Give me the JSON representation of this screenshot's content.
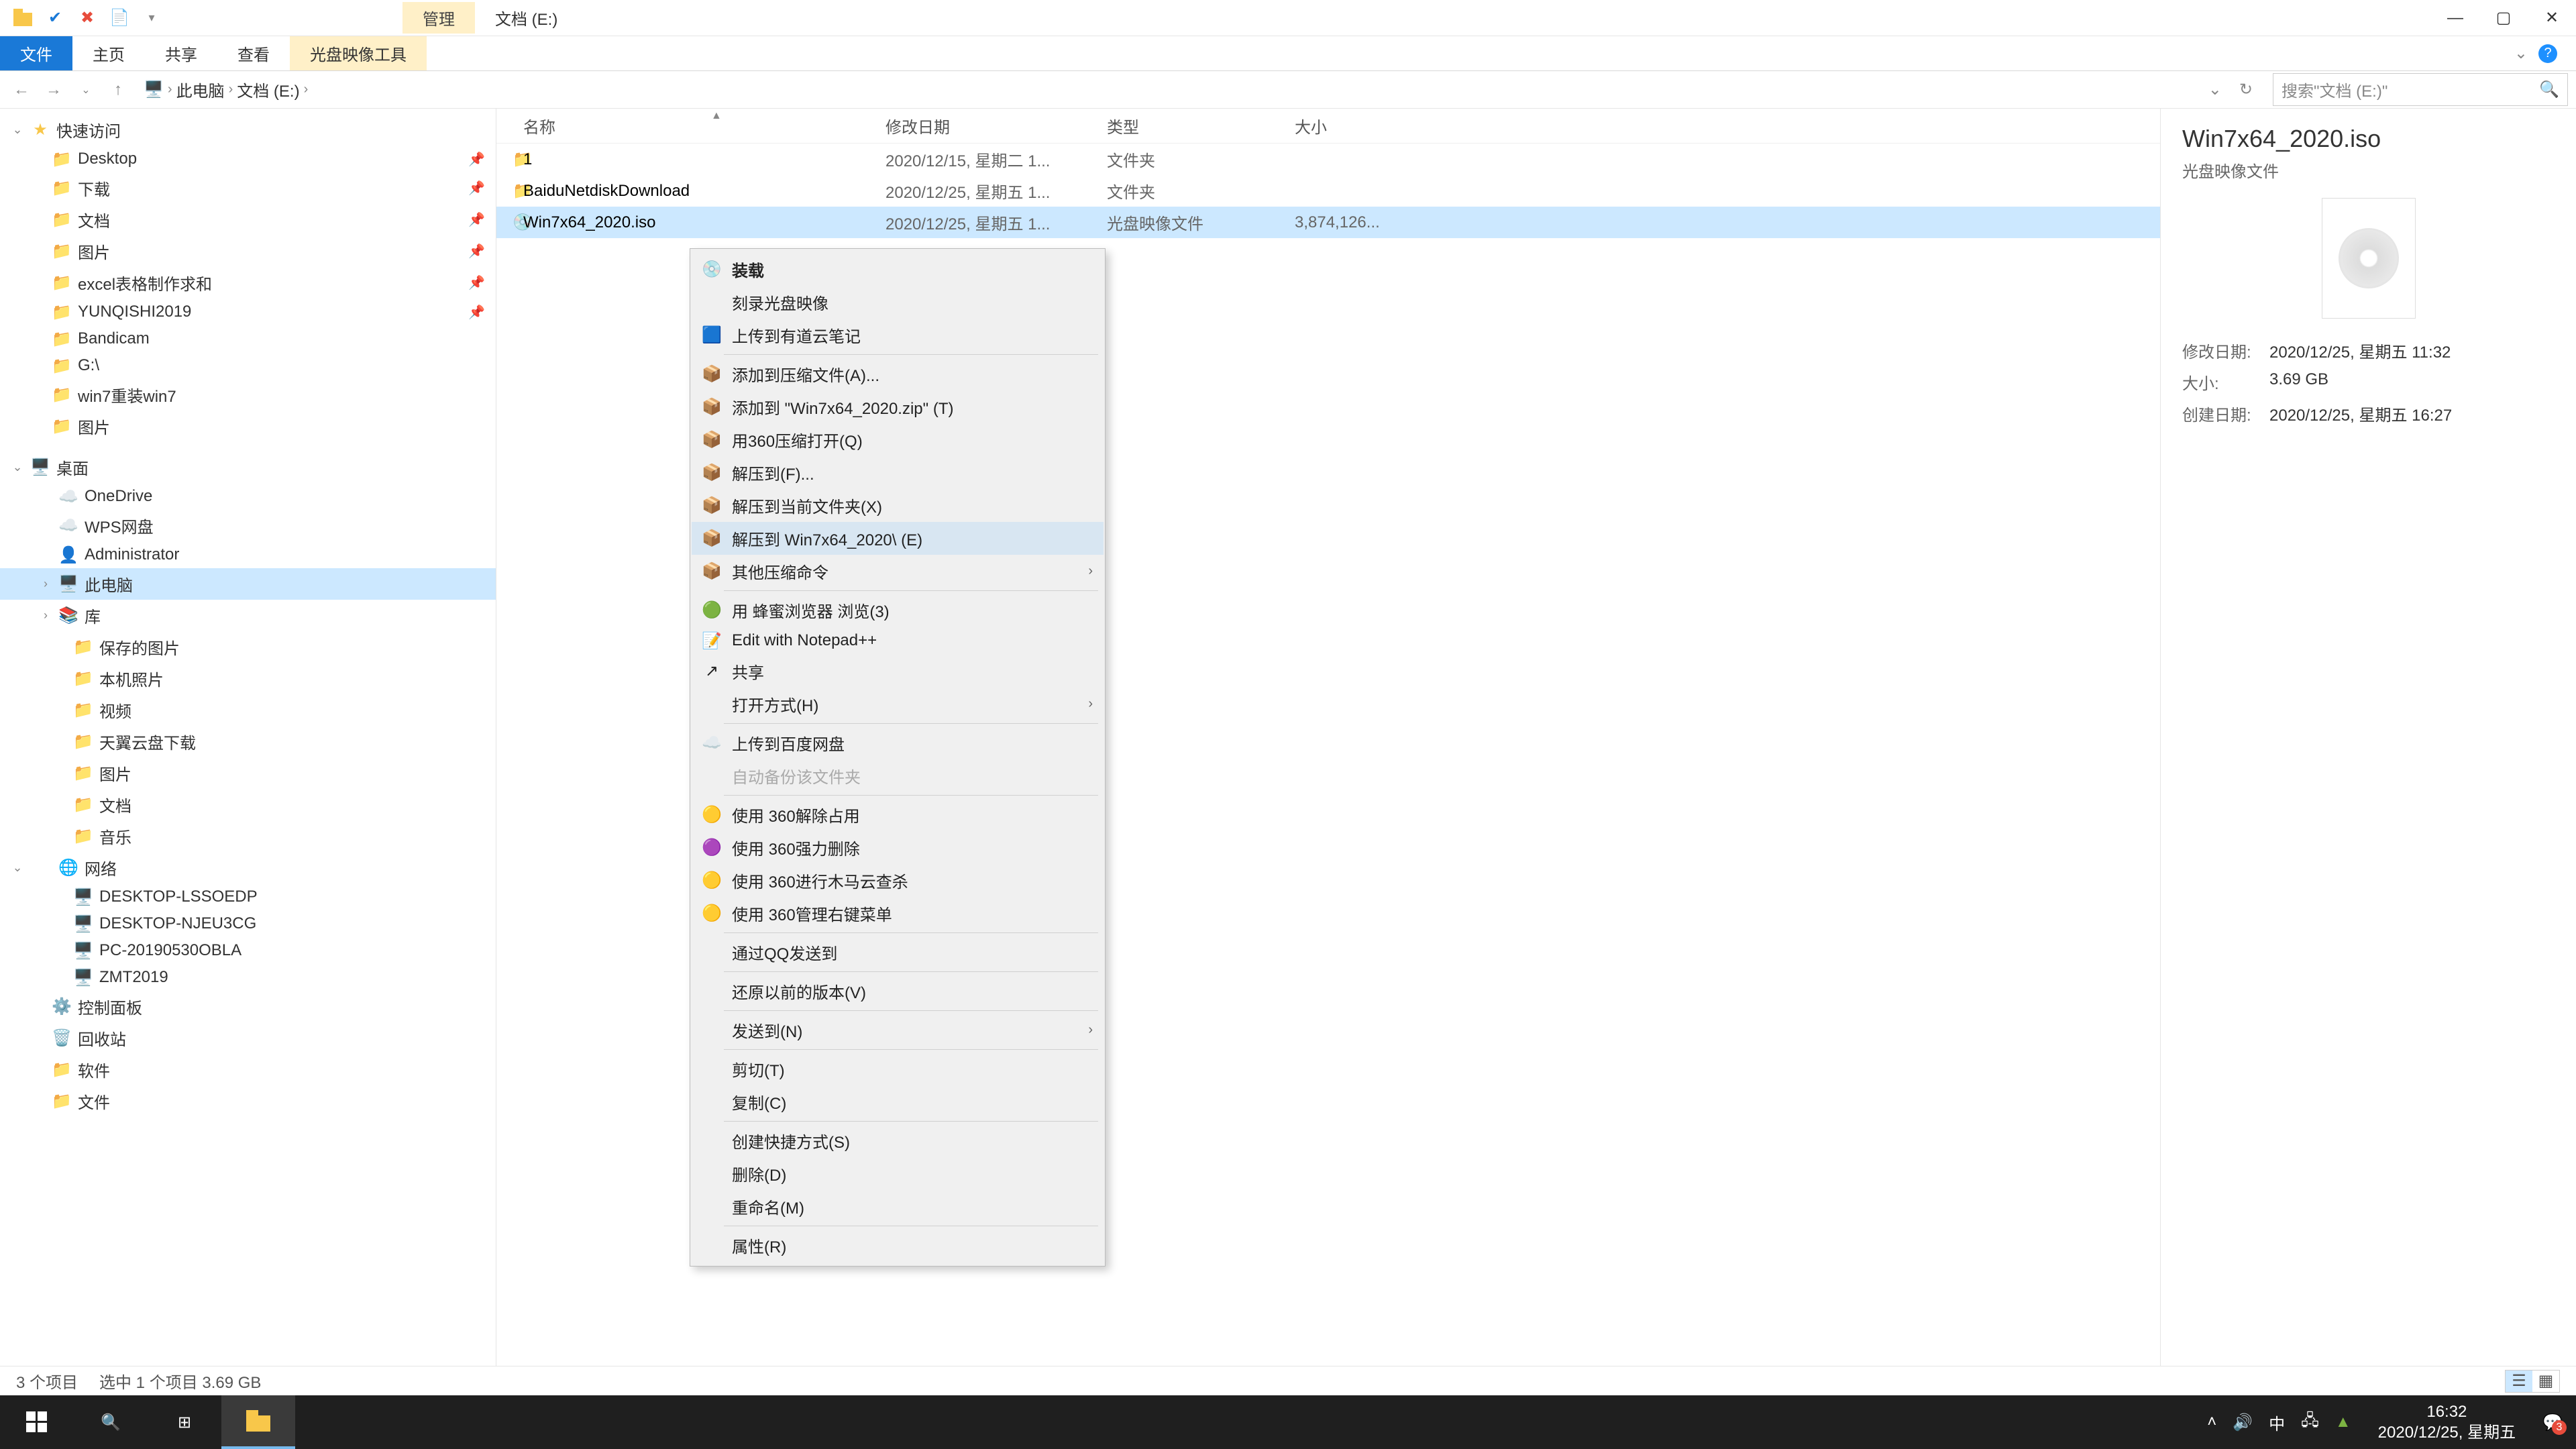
{
  "titlebar": {
    "tab_highlight": "管理",
    "title": "文档 (E:)"
  },
  "ribbon": {
    "tabs": [
      "文件",
      "主页",
      "共享",
      "查看",
      "光盘映像工具"
    ]
  },
  "address": {
    "crumbs": [
      "此电脑",
      "文档 (E:)"
    ],
    "search_placeholder": "搜索\"文档 (E:)\""
  },
  "tree": {
    "quick_access": "快速访问",
    "quick_items": [
      {
        "label": "Desktop",
        "pinned": true
      },
      {
        "label": "下载",
        "pinned": true
      },
      {
        "label": "文档",
        "pinned": true
      },
      {
        "label": "图片",
        "pinned": true
      },
      {
        "label": "excel表格制作求和",
        "pinned": true
      },
      {
        "label": "YUNQISHI2019",
        "pinned": true
      },
      {
        "label": "Bandicam"
      },
      {
        "label": "G:\\"
      },
      {
        "label": "win7重装win7"
      },
      {
        "label": "图片"
      }
    ],
    "desktop": "桌面",
    "desktop_items": [
      "OneDrive",
      "WPS网盘",
      "Administrator",
      "此电脑",
      "库"
    ],
    "library_items": [
      "保存的图片",
      "本机照片",
      "视频",
      "天翼云盘下载",
      "图片",
      "文档",
      "音乐"
    ],
    "network": "网络",
    "network_items": [
      "DESKTOP-LSSOEDP",
      "DESKTOP-NJEU3CG",
      "PC-20190530OBLA",
      "ZMT2019"
    ],
    "footer_items": [
      "控制面板",
      "回收站",
      "软件",
      "文件"
    ]
  },
  "columns": {
    "name": "名称",
    "date": "修改日期",
    "type": "类型",
    "size": "大小"
  },
  "rows": [
    {
      "name": "1",
      "date": "2020/12/15, 星期二 1...",
      "type": "文件夹",
      "size": "",
      "icon": "folder"
    },
    {
      "name": "BaiduNetdiskDownload",
      "date": "2020/12/25, 星期五 1...",
      "type": "文件夹",
      "size": "",
      "icon": "folder"
    },
    {
      "name": "Win7x64_2020.iso",
      "date": "2020/12/25, 星期五 1...",
      "type": "光盘映像文件",
      "size": "3,874,126...",
      "icon": "disc",
      "selected": true
    }
  ],
  "details": {
    "title": "Win7x64_2020.iso",
    "subtitle": "光盘映像文件",
    "rows": [
      {
        "label": "修改日期:",
        "value": "2020/12/25, 星期五 11:32"
      },
      {
        "label": "大小:",
        "value": "3.69 GB"
      },
      {
        "label": "创建日期:",
        "value": "2020/12/25, 星期五 16:27"
      }
    ]
  },
  "context": {
    "items": [
      {
        "label": "装载",
        "icon": "disc",
        "bold": true
      },
      {
        "label": "刻录光盘映像"
      },
      {
        "label": "上传到有道云笔记",
        "icon": "blue-square"
      },
      {
        "sep": true
      },
      {
        "label": "添加到压缩文件(A)...",
        "icon": "archive"
      },
      {
        "label": "添加到 \"Win7x64_2020.zip\" (T)",
        "icon": "archive"
      },
      {
        "label": "用360压缩打开(Q)",
        "icon": "archive"
      },
      {
        "label": "解压到(F)...",
        "icon": "archive"
      },
      {
        "label": "解压到当前文件夹(X)",
        "icon": "archive"
      },
      {
        "label": "解压到 Win7x64_2020\\ (E)",
        "icon": "archive",
        "hovered": true
      },
      {
        "label": "其他压缩命令",
        "icon": "archive",
        "submenu": true
      },
      {
        "sep": true
      },
      {
        "label": "用 蜂蜜浏览器 浏览(3)",
        "icon": "green"
      },
      {
        "label": "Edit with Notepad++",
        "icon": "npp"
      },
      {
        "label": "共享",
        "icon": "share"
      },
      {
        "label": "打开方式(H)",
        "submenu": true
      },
      {
        "sep": true
      },
      {
        "label": "上传到百度网盘",
        "icon": "baidu"
      },
      {
        "label": "自动备份该文件夹",
        "disabled": true
      },
      {
        "sep": true
      },
      {
        "label": "使用 360解除占用",
        "icon": "360"
      },
      {
        "label": "使用 360强力删除",
        "icon": "360del"
      },
      {
        "label": "使用 360进行木马云查杀",
        "icon": "360y"
      },
      {
        "label": "使用 360管理右键菜单",
        "icon": "360y"
      },
      {
        "sep": true
      },
      {
        "label": "通过QQ发送到"
      },
      {
        "sep": true
      },
      {
        "label": "还原以前的版本(V)"
      },
      {
        "sep": true
      },
      {
        "label": "发送到(N)",
        "submenu": true
      },
      {
        "sep": true
      },
      {
        "label": "剪切(T)"
      },
      {
        "label": "复制(C)"
      },
      {
        "sep": true
      },
      {
        "label": "创建快捷方式(S)"
      },
      {
        "label": "删除(D)"
      },
      {
        "label": "重命名(M)"
      },
      {
        "sep": true
      },
      {
        "label": "属性(R)"
      }
    ]
  },
  "status": {
    "count": "3 个项目",
    "selected": "选中 1 个项目  3.69 GB"
  },
  "taskbar": {
    "time": "16:32",
    "date": "2020/12/25, 星期五",
    "ime": "中",
    "badge": "3"
  }
}
